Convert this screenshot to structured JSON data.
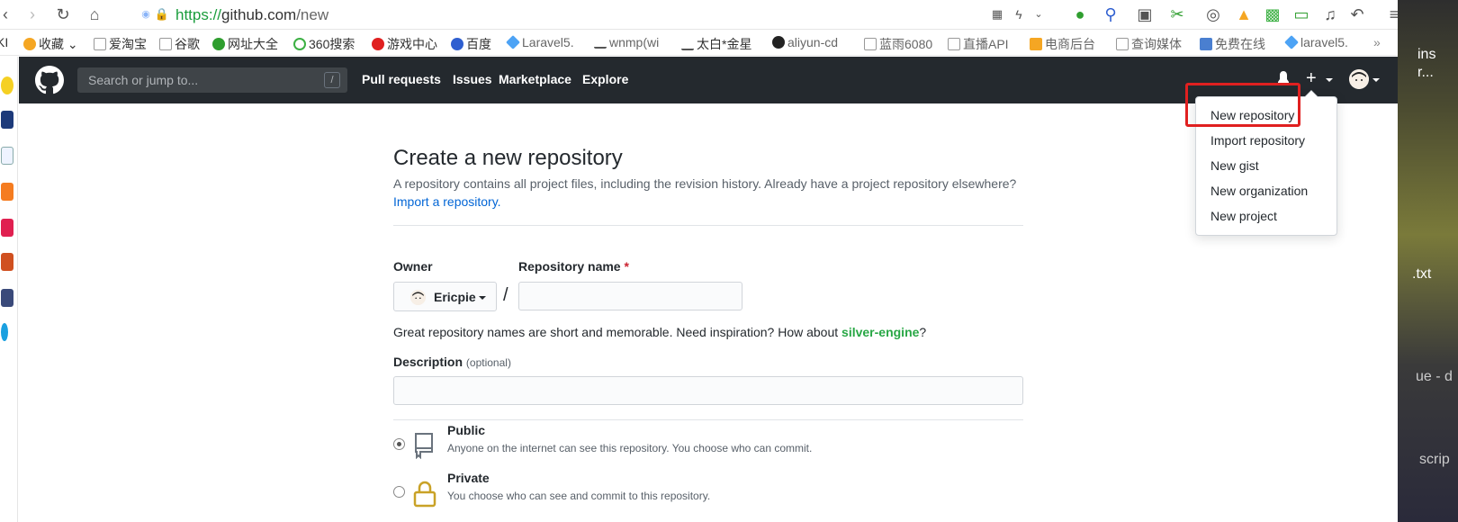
{
  "browser": {
    "url_scheme": "https://",
    "url_host": "github.com",
    "url_path": "/new"
  },
  "bookmarks": [
    {
      "label": "收藏",
      "color": "#f5a623"
    },
    {
      "label": "爱淘宝",
      "color": "#cccccc"
    },
    {
      "label": "谷歌",
      "color": "#cccccc"
    },
    {
      "label": "网址大全",
      "color": "#2f9e2f"
    },
    {
      "label": "360搜索",
      "color": "#3cb043"
    },
    {
      "label": "游戏中心",
      "color": "#e02020"
    },
    {
      "label": "百度",
      "color": "#2f5fd0"
    },
    {
      "label": "Laravel5.",
      "color": "#4da3f5"
    },
    {
      "label": "wnmp(wi",
      "color": "#555555"
    },
    {
      "label": "太白*金星",
      "color": "#555555"
    },
    {
      "label": "aliyun-cd",
      "color": "#222222"
    },
    {
      "label": "蓝雨6080",
      "color": "#cccccc"
    },
    {
      "label": "直播API",
      "color": "#cccccc"
    },
    {
      "label": "电商后台",
      "color": "#f5a623"
    },
    {
      "label": "查询媒体",
      "color": "#cccccc"
    },
    {
      "label": "免费在线",
      "color": "#4a7fd0"
    },
    {
      "label": "laravel5.",
      "color": "#4da3f5"
    }
  ],
  "header": {
    "search_placeholder": "Search or jump to...",
    "slash": "/",
    "nav": [
      "Pull requests",
      "Issues",
      "Marketplace",
      "Explore"
    ]
  },
  "dropdown": {
    "items": [
      "New repository",
      "Import repository",
      "New gist",
      "New organization",
      "New project"
    ]
  },
  "main": {
    "title": "Create a new repository",
    "intro": "A repository contains all project files, including the revision history. Already have a project repository elsewhere?",
    "import_link": "Import a repository.",
    "owner_label": "Owner",
    "owner_name": "Ericpie",
    "repo_label": "Repository name",
    "required_mark": "*",
    "separator": "/",
    "hint_prefix": "Great repository names are short and memorable. Need inspiration? How about ",
    "suggestion": "silver-engine",
    "hint_suffix": "?",
    "description_label": "Description",
    "description_optional": "(optional)",
    "public_title": "Public",
    "public_desc": "Anyone on the internet can see this repository. You choose who can commit.",
    "private_title": "Private",
    "private_desc": "You choose who can see and commit to this repository."
  },
  "desktop": {
    "labels": [
      "ins",
      "r...",
      ".txt",
      "ue - d",
      "scrip"
    ]
  }
}
